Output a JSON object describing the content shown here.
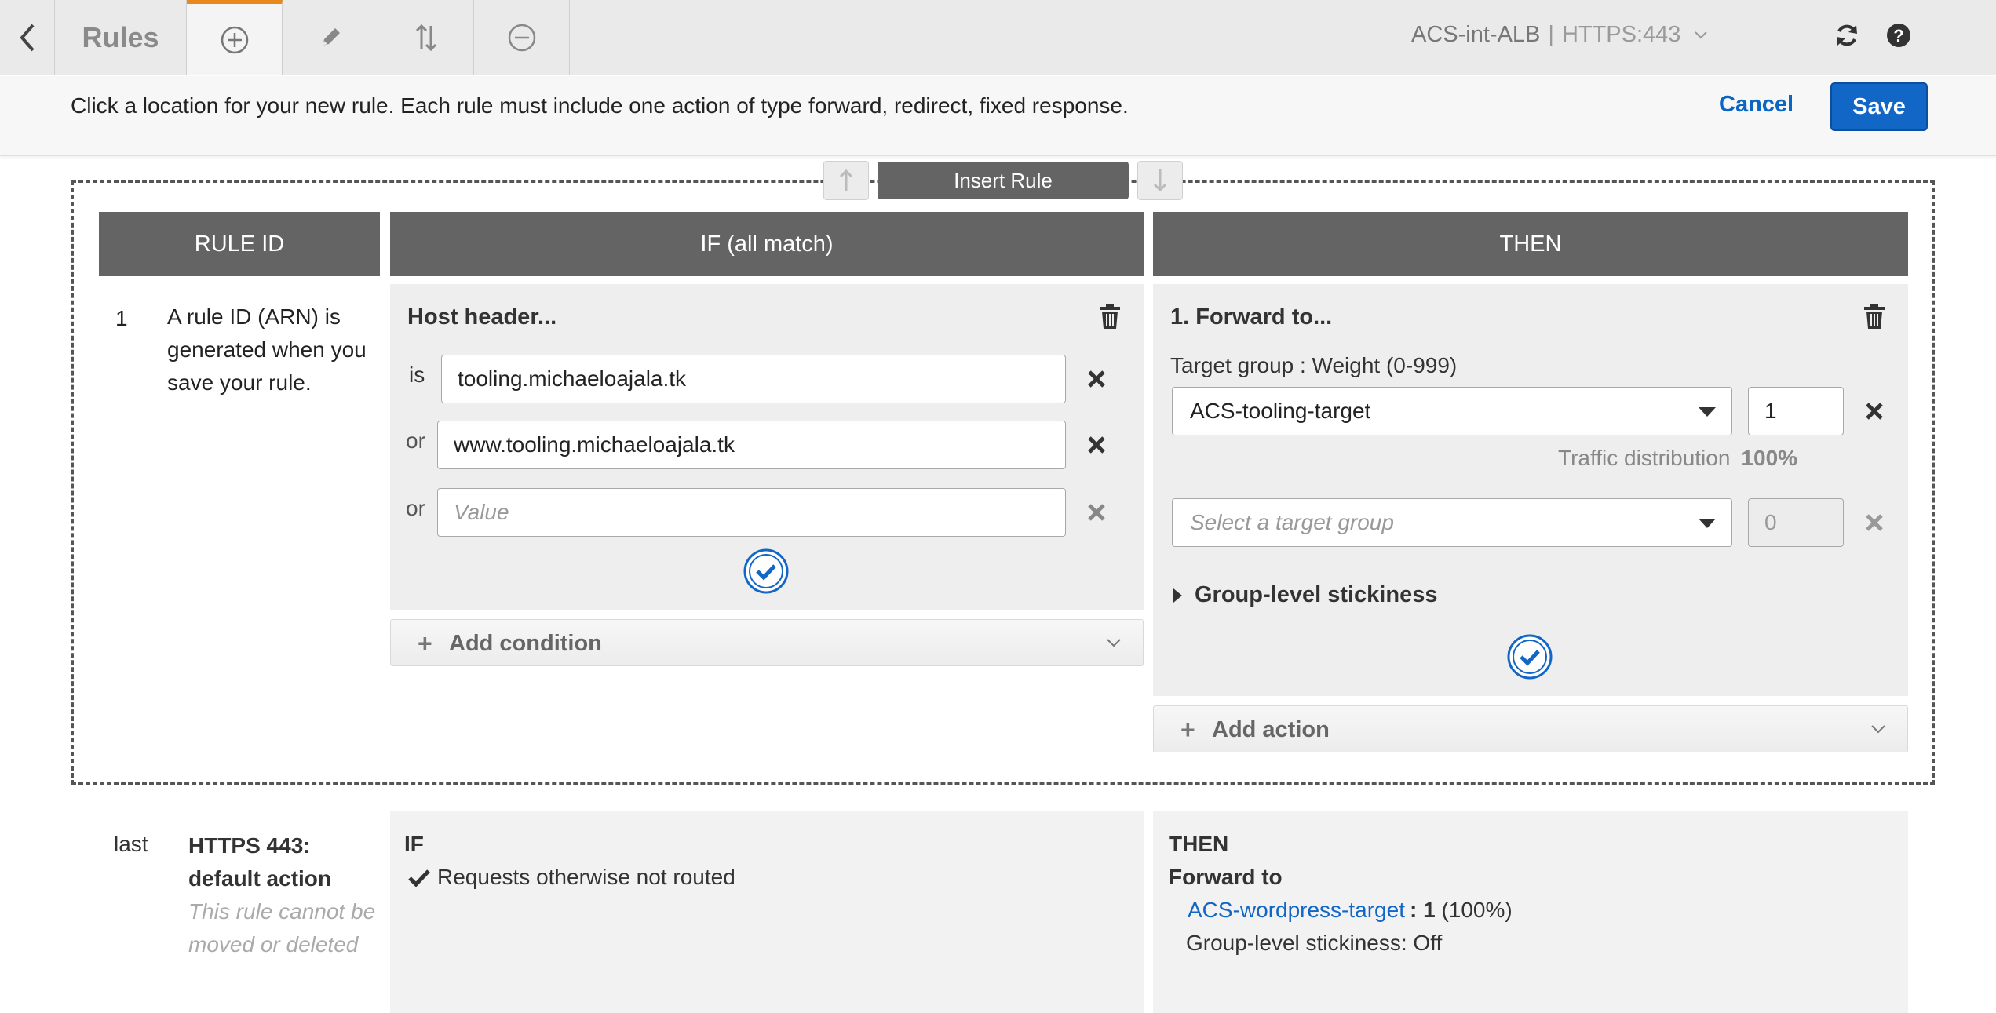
{
  "header": {
    "title": "Rules",
    "load_balancer": "ACS-int-ALB",
    "separator": "|",
    "listener": "HTTPS:443"
  },
  "tabs": [
    {
      "name": "add-rules",
      "icon": "plus-circle-icon",
      "active": true
    },
    {
      "name": "edit-rules",
      "icon": "pencil-icon",
      "active": false
    },
    {
      "name": "reorder-rules",
      "icon": "reorder-icon",
      "active": false
    },
    {
      "name": "delete-rules",
      "icon": "minus-circle-icon",
      "active": false
    }
  ],
  "message": {
    "text": "Click a location for your new rule. Each rule must include one action of type forward, redirect, fixed response.",
    "cancel_label": "Cancel",
    "save_label": "Save"
  },
  "insert": {
    "label": "Insert Rule"
  },
  "columns": {
    "rule_id": "RULE ID",
    "if": "IF (all match)",
    "then": "THEN"
  },
  "new_rule": {
    "number": "1",
    "id_text": "A rule ID (ARN) is generated when you save your rule.",
    "condition": {
      "title": "Host header...",
      "rows": [
        {
          "label": "is",
          "value": "tooling.michaeloajala.tk"
        },
        {
          "label": "or",
          "value": "www.tooling.michaeloajala.tk"
        },
        {
          "label": "or",
          "placeholder": "Value"
        }
      ],
      "add_condition_label": "Add condition"
    },
    "action": {
      "title": "1. Forward to...",
      "target_group_label": "Target group : Weight (0-999)",
      "target_group_1": "ACS-tooling-target",
      "weight_1": "1",
      "traffic_label": "Traffic distribution",
      "traffic_value": "100%",
      "target_group_placeholder": "Select a target group",
      "weight_2": "0",
      "stickiness_label": "Group-level stickiness",
      "add_action_label": "Add action"
    }
  },
  "default_rule": {
    "position": "last",
    "title": "HTTPS 443: default action",
    "note": "This rule cannot be moved or deleted",
    "if_heading": "IF",
    "if_text": "Requests otherwise not routed",
    "then_heading": "THEN",
    "then_action": "Forward to",
    "target_group": "ACS-wordpress-target",
    "target_weight": "1",
    "target_pct": "(100%)",
    "stickiness": "Group-level stickiness: Off"
  },
  "colors": {
    "accent_tab": "#e8891d",
    "primary_button": "#1266c6",
    "header_bg": "#646464",
    "link": "#1266c6"
  }
}
